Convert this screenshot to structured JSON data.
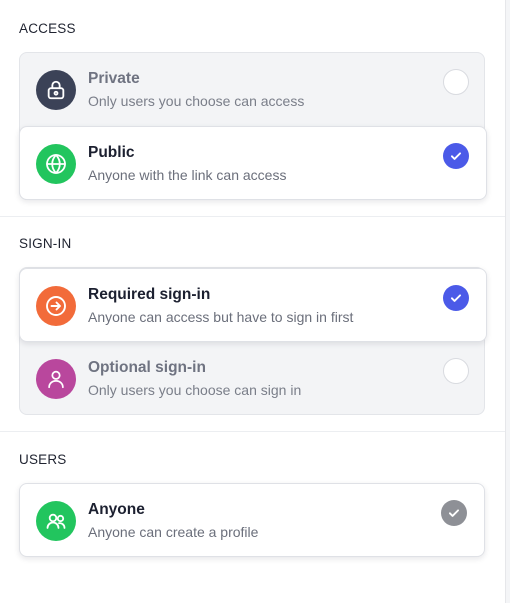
{
  "sections": {
    "access": {
      "title": "ACCESS",
      "options": [
        {
          "title": "Private",
          "description": "Only users you choose can access",
          "icon": "lock-icon",
          "icon_color": "#3b4257",
          "selected": false
        },
        {
          "title": "Public",
          "description": "Anyone with the link can access",
          "icon": "globe-icon",
          "icon_color": "#22c55e",
          "selected": true
        }
      ]
    },
    "signin": {
      "title": "SIGN-IN",
      "options": [
        {
          "title": "Required sign-in",
          "description": "Anyone can access but have to sign in first",
          "icon": "sign-in-arrow-icon",
          "icon_color": "#f26b3a",
          "selected": true
        },
        {
          "title": "Optional sign-in",
          "description": "Only users you choose can sign in",
          "icon": "user-icon",
          "icon_color": "#b9479d",
          "selected": false
        }
      ]
    },
    "users": {
      "title": "USERS",
      "options": [
        {
          "title": "Anyone",
          "description": "Anyone can create a profile",
          "icon": "users-icon",
          "icon_color": "#22c55e",
          "selected": true,
          "disabled": true
        }
      ]
    }
  },
  "colors": {
    "accent": "#4b5ae8",
    "check_disabled": "#8e9096"
  }
}
